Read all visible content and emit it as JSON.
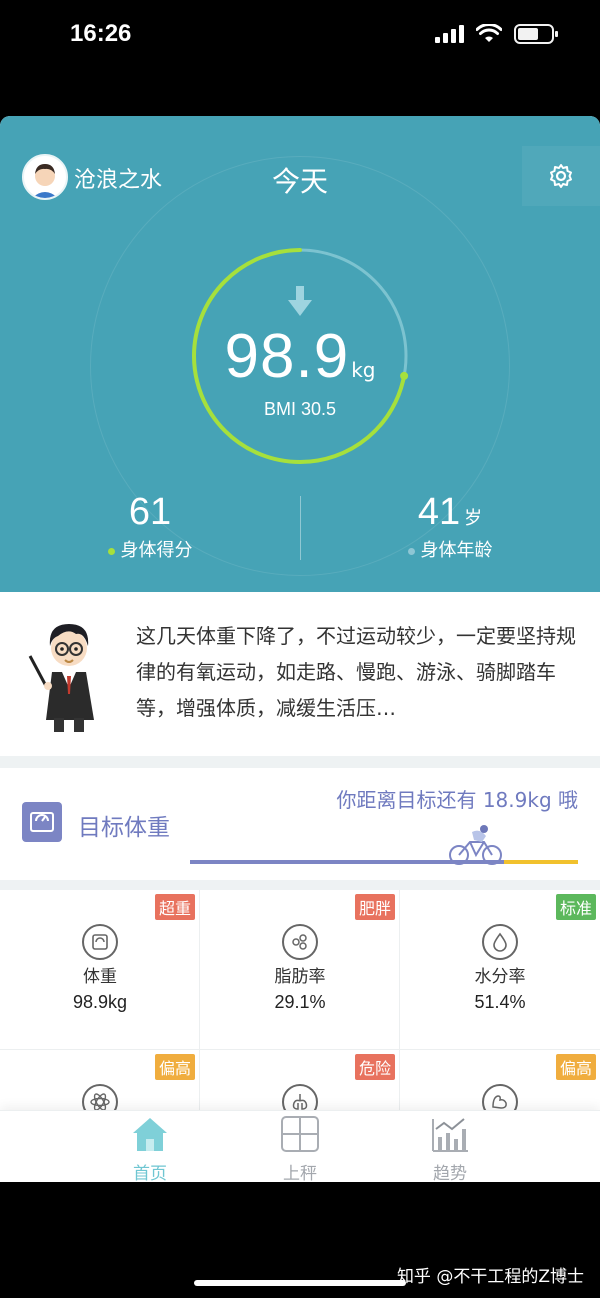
{
  "status": {
    "time": "16:26"
  },
  "header": {
    "username": "沧浪之水",
    "title": "今天"
  },
  "weight": {
    "value": "98.9",
    "unit": "kg",
    "bmi": "BMI 30.5",
    "progress": 0.72
  },
  "stats": [
    {
      "value": "61",
      "unit": "",
      "label": "身体得分",
      "dot_color": "#a6e03c"
    },
    {
      "value": "41",
      "unit": "岁",
      "label": "身体年龄",
      "dot_color": "#8ec6d4"
    }
  ],
  "advice": {
    "text": "这几天体重下降了，不过运动较少，一定要坚持规律的有氧运动，如走路、慢跑、游泳、骑脚踏车等，增强体质，减缓生活压…"
  },
  "goal": {
    "label": "目标体重",
    "tip": "你距离目标还有 18.9kg 哦",
    "progress": 0.81
  },
  "metrics": [
    {
      "name": "体重",
      "value": "98.9kg",
      "tag": "超重",
      "tag_color": "#e8725e",
      "icon": "scale-icon"
    },
    {
      "name": "脂肪率",
      "value": "29.1%",
      "tag": "肥胖",
      "tag_color": "#e8725e",
      "icon": "fat-icon"
    },
    {
      "name": "水分率",
      "value": "51.4%",
      "tag": "标准",
      "tag_color": "#5cb85c",
      "icon": "water-drop-icon"
    },
    {
      "name": "",
      "value": "",
      "tag": "偏高",
      "tag_color": "#f0ad3e",
      "icon": "atom-icon"
    },
    {
      "name": "",
      "value": "",
      "tag": "危险",
      "tag_color": "#e8725e",
      "icon": "lungs-icon"
    },
    {
      "name": "",
      "value": "",
      "tag": "偏高",
      "tag_color": "#f0ad3e",
      "icon": "muscle-icon"
    }
  ],
  "tabs": [
    {
      "label": "首页",
      "icon": "home-icon",
      "active": true
    },
    {
      "label": "上秤",
      "icon": "scale-tab-icon",
      "active": false
    },
    {
      "label": "趋势",
      "icon": "trend-icon",
      "active": false
    }
  ],
  "watermark": "知乎 @不干工程的Z博士",
  "colors": {
    "primary": "#46a3b6",
    "accent_green": "#a6e03c",
    "goal_purple": "#7c85c4",
    "goal_yellow": "#f1c12d"
  }
}
